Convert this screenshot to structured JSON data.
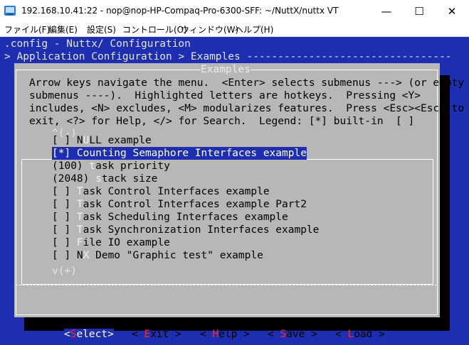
{
  "window": {
    "title": "192.168.10.41:22 - nop@nop-HP-Compaq-Pro-6300-SFF: ~/NuttX/nuttx VT",
    "minimize_glyph": "—",
    "maximize_glyph": "☐",
    "close_glyph": "✕"
  },
  "menubar": [
    "ファイル(F)",
    "編集(E)",
    "設定(S)",
    "コントロール(O)",
    "ウィンドウ(W)",
    "ヘルプ(H)"
  ],
  "terminal": {
    "header_line1": ".config - Nuttx/ Configuration",
    "header_line2": "> Application Configuration > Examples ---------------------------------",
    "dialog_title": "Examples",
    "help_lines": [
      "Arrow keys navigate the menu.  <Enter> selects submenus ---> (or empty",
      "submenus ----).  Highlighted letters are hotkeys.  Pressing <Y>",
      "includes, <N> excludes, <M> modularizes features.  Press <Esc><Esc> to",
      "exit, <?> for Help, </> for Search.  Legend: [*] built-in  [ ]"
    ],
    "scroll_up": "^(-)",
    "scroll_down": "v(+)",
    "items": [
      {
        "pre": "[ ] N",
        "hk": "U",
        "post": "LL example"
      },
      {
        "pre": "[*] ",
        "hk": "C",
        "post": "ounting Semaphore Interfaces example"
      },
      {
        "pre": "(100) ",
        "hk": "t",
        "post": "ask priority"
      },
      {
        "pre": "(2048) ",
        "hk": "s",
        "post": "tack size"
      },
      {
        "pre": "[ ] ",
        "hk": "T",
        "post": "ask Control Interfaces example"
      },
      {
        "pre": "[ ] ",
        "hk": "T",
        "post": "ask Control Interfaces example Part2"
      },
      {
        "pre": "[ ] ",
        "hk": "T",
        "post": "ask Scheduling Interfaces example"
      },
      {
        "pre": "[ ] ",
        "hk": "T",
        "post": "ask Synchronization Interfaces example"
      },
      {
        "pre": "[ ] ",
        "hk": "F",
        "post": "ile IO example"
      },
      {
        "pre": "[ ] N",
        "hk": "X",
        "post": " Demo \"Graphic test\" example"
      }
    ],
    "selected_index": 1,
    "buttons": [
      {
        "pre": "<",
        "hk": "S",
        "post": "elect>"
      },
      {
        "pre": "< ",
        "hk": "E",
        "post": "xit >"
      },
      {
        "pre": "< ",
        "hk": "H",
        "post": "elp >"
      },
      {
        "pre": "< ",
        "hk": "S",
        "post": "ave >"
      },
      {
        "pre": "< ",
        "hk": "L",
        "post": "oad >"
      }
    ]
  },
  "colors": {
    "terminal_bg": "#1d2fb0",
    "dialog_bg": "#b7b7b7",
    "hotkey": "#ff2a2a"
  }
}
